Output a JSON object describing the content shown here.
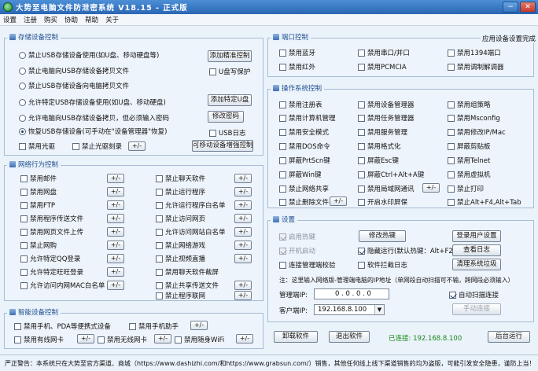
{
  "window": {
    "title": "大势至电脑文件防泄密系统 V18.15 - 正式版",
    "minimize": "−",
    "close": "✕"
  },
  "menu": [
    "设置",
    "注册",
    "购买",
    "协助",
    "帮助",
    "关于"
  ],
  "storage": {
    "title": "存储设备控制",
    "radios": [
      "禁止USB存储设备使用(如U盘、移动硬盘等)",
      "禁止电脑向USB存储设备拷贝文件",
      "禁止USB存储设备向电脑拷贝文件",
      "允许特定USB存储设备使用(如U盘、移动硬盘)",
      "允许电脑向USB存储设备拷贝，但必须输入密码",
      "恢复USB存储设备(可手动在\"设备管理器\"恢复)"
    ],
    "btn_add_precise": "添加精准控制",
    "cb_write_protect": "U盘写保护",
    "btn_add_udisk": "添加特定U盘",
    "btn_change_pw": "修改密码",
    "cb_usb_log": "USB日志",
    "cb_disable_cd": "禁用光驱",
    "cb_disable_burn": "禁止光驱刻录",
    "btn_mobile_dev": "可移动设备增强控制"
  },
  "network": {
    "title": "网络行为控制",
    "left": [
      "禁用邮件",
      "禁用网盘",
      "禁用FTP",
      "禁用程序传送文件",
      "禁用网页文件上传",
      "禁止网购",
      "允许特定QQ登录",
      "允许特定旺旺登录",
      "允许访问内网MAC白名单"
    ],
    "right": [
      "禁止聊天软件",
      "禁止运行程序",
      "允许运行程序白名单",
      "禁止访问网页",
      "允许访问网站白名单",
      "禁止网络游戏",
      "禁止视频直播",
      "禁用聊天软件截屏",
      "禁止共享传送文件",
      "禁止程序联网"
    ]
  },
  "smart": {
    "title": "智能设备控制",
    "items": [
      "禁用手机、PDA等便携式设备",
      "禁用手机助手",
      "禁用有线网卡",
      "禁用无线网卡",
      "禁用随身WiFi"
    ]
  },
  "ports": {
    "title": "端口控制",
    "status": "应用设备设置完成",
    "items": [
      "禁用蓝牙",
      "禁用串口/并口",
      "禁用1394端口",
      "禁用红外",
      "禁用PCMCIA",
      "禁用调制解调器"
    ]
  },
  "os": {
    "title": "操作系统控制",
    "col1": [
      "禁用注册表",
      "禁用计算机管理",
      "禁用安全模式",
      "禁用DOS命令",
      "屏蔽PrtScn键",
      "屏蔽Win键",
      "禁止网络共享",
      "禁止删除文件"
    ],
    "col2": [
      "禁用设备管理器",
      "禁用任务管理器",
      "禁用服务管理",
      "禁用格式化",
      "屏蔽Esc键",
      "屏蔽Ctrl+Alt+A键",
      "禁用局域网通讯",
      "开启水印屏保"
    ],
    "col3": [
      "禁用组策略",
      "禁用Msconfig",
      "禁用修改IP/Mac",
      "屏蔽剪贴板",
      "禁用Telnet",
      "禁用虚拟机",
      "禁止打印",
      "禁止Alt+F4,Alt+Tab"
    ]
  },
  "settings": {
    "title": "设置",
    "cb_hotkey": "启用热键",
    "cb_autostart": "开机启动",
    "cb_hidden": "隐藏运行(默认热键：Alt+F2)",
    "cb_connect_check": "连接管理端校验",
    "cb_block_log": "软件拦截日志",
    "btn_hotkey": "修改热键",
    "btn_login": "登录用户设置",
    "btn_view_log": "查看日志",
    "btn_clean": "清理系统垃圾",
    "note": "注：这里输入网络版-管理端电脑的IP地址（单网段自动扫描可不输，跨网段必须输入）",
    "mgr_ip_label": "管理端IP:",
    "mgr_ip_value": "0 . 0 . 0 . 0",
    "cb_auto_scan": "自动扫描连接",
    "client_ip_label": "客户端IP:",
    "client_ip_value": "192.168.8.100",
    "btn_manual_connect": "手动连接"
  },
  "actions": {
    "uninstall": "卸载软件",
    "exit": "退出软件",
    "connected": "已连接: 192.168.8.100",
    "background": "后台运行"
  },
  "footer": "严正警告：本系统只在大势至官方渠道、商城（https://www.dashizhi.com/和https://www.grabsun.com/）销售，其他任何线上线下渠道销售的均为盗版，可能引发安全隐患，谨防上当！",
  "small_btn": "+/-"
}
